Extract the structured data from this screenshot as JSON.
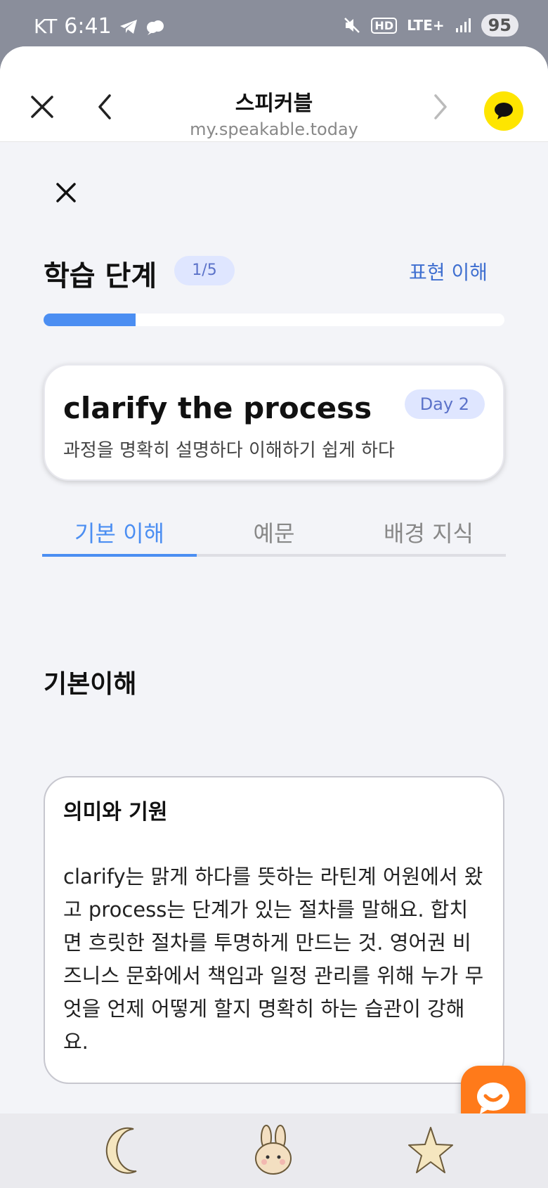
{
  "status_bar": {
    "carrier": "KT",
    "time": "6:41",
    "network": "LTE+",
    "battery": "95"
  },
  "browser": {
    "site_name": "스피커블",
    "url": "my.speakable.today"
  },
  "step": {
    "title": "학습 단계",
    "badge": "1/5",
    "current_step_name": "표현 이해",
    "progress": 0.2
  },
  "expression_card": {
    "expression": "clarify the process",
    "meaning": "과정을 명확히 설명하다 이해하기 쉽게 하다",
    "day": "Day 2"
  },
  "tabs": [
    {
      "label": "기본 이해",
      "active": true
    },
    {
      "label": "예문",
      "active": false
    },
    {
      "label": "배경 지식",
      "active": false
    }
  ],
  "section": {
    "title": "기본이해",
    "box_title": "의미와 기원",
    "box_body": "clarify는 맑게 하다를 뜻하는 라틴계 어원에서 왔고 process는 단계가 있는 절차를 말해요. 합치면 흐릿한 절차를 투명하게 만드는 것. 영어권 비즈니스 문화에서 책임과 일정 관리를 위해 누가 무엇을 언제 어떻게 할지 명확히 하는 습관이 강해요."
  },
  "bottom_nav": [
    {
      "icon": "moon-icon"
    },
    {
      "icon": "rabbit-icon"
    },
    {
      "icon": "star-icon"
    }
  ],
  "colors": {
    "accent": "#4b8ef2",
    "badge_bg": "#dfe6ff",
    "chat_fab": "#ff7a1a",
    "kakao_yellow": "#fee500"
  }
}
